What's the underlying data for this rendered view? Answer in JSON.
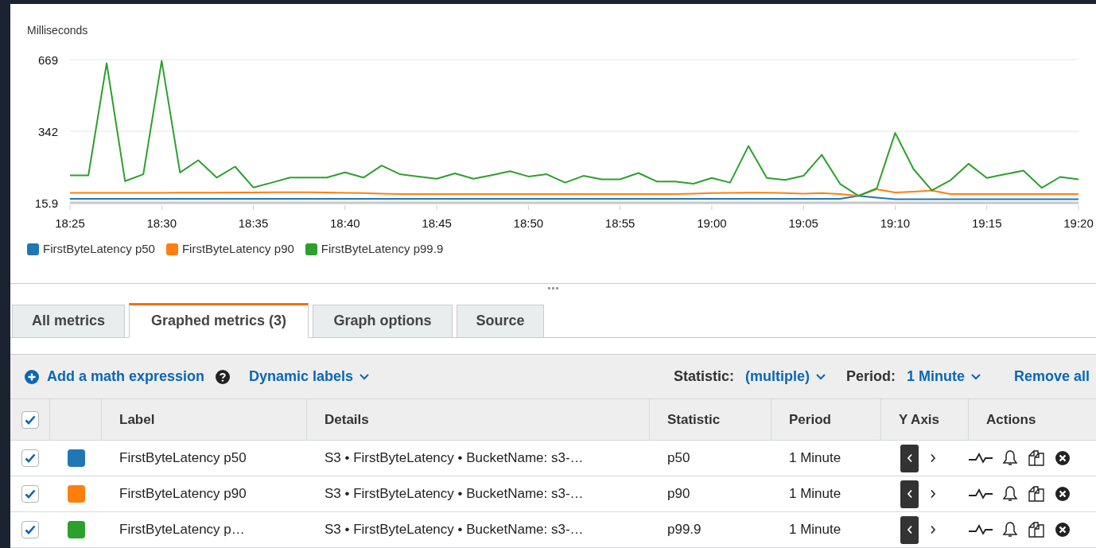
{
  "chart": {
    "chart_data": {
      "type": "line",
      "ylabel": "Milliseconds",
      "categories": [
        "18:25",
        null,
        null,
        null,
        null,
        "18:30",
        null,
        null,
        null,
        null,
        "18:35",
        null,
        null,
        null,
        null,
        "18:40",
        null,
        null,
        null,
        null,
        "18:45",
        null,
        null,
        null,
        null,
        "18:50",
        null,
        null,
        null,
        null,
        "18:55",
        null,
        null,
        null,
        null,
        "19:00",
        null,
        null,
        null,
        null,
        "19:05",
        null,
        null,
        null,
        null,
        "19:10",
        null,
        null,
        null,
        null,
        "19:15",
        null,
        null,
        null,
        null,
        "19:20"
      ],
      "ylim": [
        15.9,
        669
      ],
      "yticks": [
        15.9,
        342,
        669
      ],
      "series": [
        {
          "name": "FirstByteLatency p50",
          "color": "#1f77b4",
          "values": [
            34,
            34,
            34,
            34,
            34,
            34,
            34,
            34,
            34,
            34,
            34,
            34,
            34,
            34,
            34,
            34,
            34,
            34,
            34,
            34,
            34,
            34,
            34,
            34,
            34,
            34,
            34,
            34,
            34,
            34,
            34,
            34,
            34,
            34,
            34,
            34,
            34,
            34,
            34,
            34,
            34,
            34,
            34,
            48,
            40,
            32,
            32,
            32,
            32,
            32,
            32,
            32,
            32,
            32,
            32,
            32
          ]
        },
        {
          "name": "FirstByteLatency p90",
          "color": "#ff7f0e",
          "values": [
            61,
            61,
            61,
            61,
            61,
            61,
            62,
            62,
            62,
            63,
            63,
            64,
            64,
            64,
            63,
            61,
            60,
            58,
            56,
            56,
            56,
            56,
            56,
            56,
            56,
            56,
            56,
            56,
            56,
            56,
            56,
            56,
            56,
            56,
            58,
            60,
            61,
            62,
            62,
            60,
            58,
            60,
            56,
            48,
            78,
            63,
            67,
            72,
            56,
            56,
            56,
            56,
            56,
            56,
            56,
            56
          ]
        },
        {
          "name": "FirstByteLatency p99.9",
          "color": "#2ca02c",
          "values": [
            141,
            141,
            653,
            115,
            146,
            664,
            154,
            210,
            131,
            181,
            86,
            108,
            131,
            131,
            131,
            155,
            131,
            186,
            146,
            136,
            126,
            150,
            126,
            142,
            160,
            136,
            146,
            108,
            139,
            123,
            123,
            152,
            113,
            113,
            103,
            129,
            108,
            275,
            129,
            120,
            139,
            235,
            102,
            48,
            82,
            335,
            170,
            73,
            118,
            194,
            129,
            146,
            163,
            84,
            134,
            123
          ]
        }
      ]
    }
  },
  "tabs": [
    {
      "label": "All metrics",
      "selected": false
    },
    {
      "label": "Graphed metrics (3)",
      "selected": true
    },
    {
      "label": "Graph options",
      "selected": false
    },
    {
      "label": "Source",
      "selected": false
    }
  ],
  "toolbar": {
    "add_expression": "Add a math expression",
    "dynamic_labels": "Dynamic labels",
    "statistic_label": "Statistic:",
    "statistic_value": "(multiple)",
    "period_label": "Period:",
    "period_value": "1 Minute",
    "remove_all": "Remove all"
  },
  "table": {
    "all_checked": true,
    "columns": [
      "Label",
      "Details",
      "Statistic",
      "Period",
      "Y Axis",
      "Actions"
    ],
    "rows": [
      {
        "checked": true,
        "color": "#1f77b4",
        "label": "FirstByteLatency p50",
        "details": "S3 • FirstByteLatency • BucketName: s3-…",
        "statistic": "p50",
        "period": "1 Minute",
        "y_left_selected": true,
        "y_right_selected": false
      },
      {
        "checked": true,
        "color": "#ff7f0e",
        "label": "FirstByteLatency p90",
        "details": "S3 • FirstByteLatency • BucketName: s3-…",
        "statistic": "p90",
        "period": "1 Minute",
        "y_left_selected": true,
        "y_right_selected": false
      },
      {
        "checked": true,
        "color": "#2ca02c",
        "label": "FirstByteLatency p…",
        "details": "S3 • FirstByteLatency • BucketName: s3-…",
        "statistic": "p99.9",
        "period": "1 Minute",
        "y_left_selected": true,
        "y_right_selected": false
      }
    ]
  }
}
